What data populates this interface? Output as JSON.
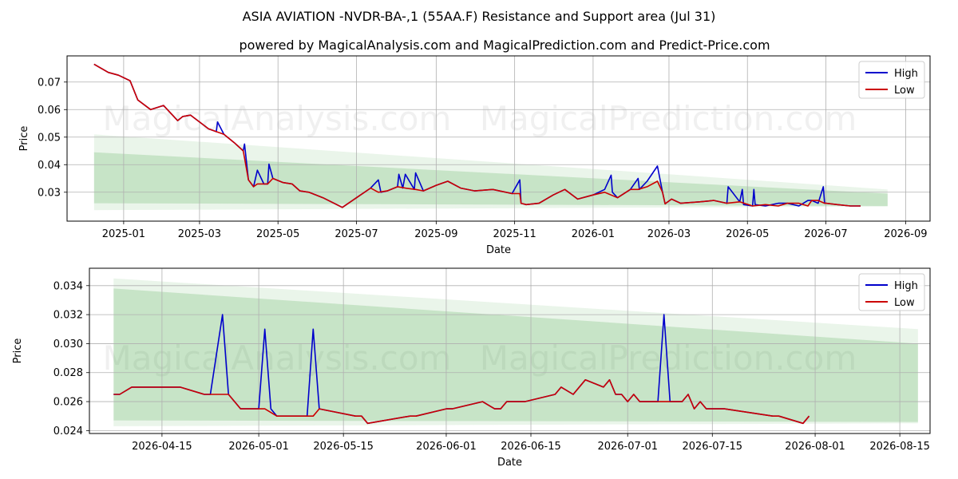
{
  "title": "ASIA AVIATION -NVDR-BA-,1 (55AA.F) Resistance and Support area (Jul 31)",
  "subtitle": "powered by MagicalAnalysis.com and MagicalPrediction.com and Predict-Price.com",
  "watermarks": [
    "MagicalAnalysis.com",
    "MagicalPrediction.com"
  ],
  "colors": {
    "high": "#0000cc",
    "low": "#cc0000",
    "band": "#2e9a2e"
  },
  "chart_data": [
    {
      "type": "line",
      "xlabel": "Date",
      "ylabel": "Price",
      "x_ticks": [
        "2025-01",
        "2025-03",
        "2025-05",
        "2025-07",
        "2025-09",
        "2025-11",
        "2026-01",
        "2026-03",
        "2026-05",
        "2026-07",
        "2026-09"
      ],
      "y_ticks": [
        "0.03",
        "0.04",
        "0.05",
        "0.06",
        "0.07"
      ],
      "xlim": [
        "2024-11-18",
        "2026-09-20"
      ],
      "ylim": [
        0.0195,
        0.0795
      ],
      "grid": true,
      "legend": "top-right",
      "bands": [
        {
          "x": [
            "2024-12-09",
            "2026-08-18"
          ],
          "upper": [
            0.051,
            0.031
          ],
          "lower": [
            0.0235,
            0.0248
          ]
        },
        {
          "x": [
            "2024-12-09",
            "2026-08-18"
          ],
          "upper": [
            0.0445,
            0.0295
          ],
          "lower": [
            0.026,
            0.025
          ]
        }
      ],
      "series": [
        {
          "name": "High",
          "x": [
            "2024-12-09",
            "2024-12-20",
            "2024-12-28",
            "2025-01-06",
            "2025-01-12",
            "2025-01-22",
            "2025-02-01",
            "2025-02-12",
            "2025-02-16",
            "2025-02-22",
            "2025-03-01",
            "2025-03-08",
            "2025-03-14",
            "2025-03-15",
            "2025-03-20",
            "2025-03-28",
            "2025-04-04",
            "2025-04-05",
            "2025-04-08",
            "2025-04-12",
            "2025-04-15",
            "2025-04-20",
            "2025-04-23",
            "2025-04-24",
            "2025-04-27",
            "2025-05-05",
            "2025-05-12",
            "2025-05-18",
            "2025-05-25",
            "2025-06-05",
            "2025-06-20",
            "2025-07-01",
            "2025-07-12",
            "2025-07-18",
            "2025-07-20",
            "2025-07-25",
            "2025-08-02",
            "2025-08-03",
            "2025-08-06",
            "2025-08-08",
            "2025-08-15",
            "2025-08-16",
            "2025-08-22",
            "2025-09-01",
            "2025-09-10",
            "2025-09-20",
            "2025-10-01",
            "2025-10-15",
            "2025-10-30",
            "2025-11-05",
            "2025-11-06",
            "2025-11-10",
            "2025-11-20",
            "2025-12-01",
            "2025-12-10",
            "2025-12-20",
            "2026-01-01",
            "2026-01-10",
            "2026-01-15",
            "2026-01-16",
            "2026-01-20",
            "2026-01-30",
            "2026-02-05",
            "2026-02-06",
            "2026-02-12",
            "2026-02-20",
            "2026-02-24",
            "2026-02-26",
            "2026-03-03",
            "2026-03-10",
            "2026-03-25",
            "2026-04-05",
            "2026-04-15",
            "2026-04-16",
            "2026-04-25",
            "2026-04-27",
            "2026-04-28",
            "2026-05-05",
            "2026-05-06",
            "2026-05-07",
            "2026-05-15",
            "2026-05-25",
            "2026-06-01",
            "2026-06-10",
            "2026-06-17",
            "2026-06-20",
            "2026-06-25",
            "2026-06-29",
            "2026-06-30",
            "2026-07-01",
            "2026-07-10",
            "2026-07-20",
            "2026-07-28"
          ],
          "values": [
            0.0765,
            0.0735,
            0.0725,
            0.0705,
            0.0635,
            0.06,
            0.0615,
            0.056,
            0.0575,
            0.058,
            0.0555,
            0.053,
            0.052,
            0.0555,
            0.051,
            0.048,
            0.045,
            0.0475,
            0.0345,
            0.032,
            0.038,
            0.033,
            0.033,
            0.0402,
            0.035,
            0.0335,
            0.033,
            0.0305,
            0.03,
            0.028,
            0.0245,
            0.028,
            0.0315,
            0.0345,
            0.03,
            0.0305,
            0.032,
            0.0365,
            0.0315,
            0.0365,
            0.031,
            0.037,
            0.0305,
            0.0325,
            0.034,
            0.0315,
            0.0305,
            0.031,
            0.0295,
            0.0345,
            0.026,
            0.0255,
            0.026,
            0.029,
            0.031,
            0.0275,
            0.029,
            0.031,
            0.0362,
            0.03,
            0.028,
            0.031,
            0.035,
            0.031,
            0.034,
            0.0395,
            0.03,
            0.0258,
            0.0275,
            0.026,
            0.0265,
            0.027,
            0.026,
            0.032,
            0.0265,
            0.031,
            0.0255,
            0.025,
            0.031,
            0.0255,
            0.025,
            0.026,
            0.026,
            0.025,
            0.027,
            0.027,
            0.026,
            0.032,
            0.026,
            0.026,
            0.0255,
            0.025,
            0.025
          ]
        },
        {
          "name": "Low",
          "x": [
            "2024-12-09",
            "2024-12-20",
            "2024-12-28",
            "2025-01-06",
            "2025-01-12",
            "2025-01-22",
            "2025-02-01",
            "2025-02-12",
            "2025-02-16",
            "2025-02-22",
            "2025-03-01",
            "2025-03-08",
            "2025-03-14",
            "2025-03-20",
            "2025-03-28",
            "2025-04-04",
            "2025-04-08",
            "2025-04-12",
            "2025-04-15",
            "2025-04-20",
            "2025-04-23",
            "2025-04-27",
            "2025-05-05",
            "2025-05-12",
            "2025-05-18",
            "2025-05-25",
            "2025-06-05",
            "2025-06-20",
            "2025-07-01",
            "2025-07-12",
            "2025-07-18",
            "2025-07-25",
            "2025-08-02",
            "2025-08-08",
            "2025-08-16",
            "2025-08-22",
            "2025-09-01",
            "2025-09-10",
            "2025-09-20",
            "2025-10-01",
            "2025-10-15",
            "2025-10-30",
            "2025-11-05",
            "2025-11-06",
            "2025-11-10",
            "2025-11-20",
            "2025-12-01",
            "2025-12-10",
            "2025-12-20",
            "2026-01-01",
            "2026-01-10",
            "2026-01-20",
            "2026-01-30",
            "2026-02-05",
            "2026-02-12",
            "2026-02-20",
            "2026-02-24",
            "2026-02-26",
            "2026-03-03",
            "2026-03-10",
            "2026-03-25",
            "2026-04-05",
            "2026-04-15",
            "2026-04-25",
            "2026-05-05",
            "2026-05-15",
            "2026-05-25",
            "2026-06-01",
            "2026-06-10",
            "2026-06-17",
            "2026-06-20",
            "2026-06-25",
            "2026-06-30",
            "2026-07-01",
            "2026-07-10",
            "2026-07-20",
            "2026-07-28"
          ],
          "values": [
            0.0765,
            0.0735,
            0.0725,
            0.0705,
            0.0635,
            0.06,
            0.0615,
            0.056,
            0.0575,
            0.058,
            0.0555,
            0.053,
            0.052,
            0.051,
            0.048,
            0.045,
            0.0345,
            0.032,
            0.033,
            0.033,
            0.033,
            0.035,
            0.0335,
            0.033,
            0.0305,
            0.03,
            0.028,
            0.0245,
            0.028,
            0.0315,
            0.03,
            0.0305,
            0.032,
            0.0315,
            0.031,
            0.0305,
            0.0325,
            0.034,
            0.0315,
            0.0305,
            0.031,
            0.0295,
            0.0295,
            0.026,
            0.0255,
            0.026,
            0.029,
            0.031,
            0.0275,
            0.029,
            0.03,
            0.028,
            0.031,
            0.031,
            0.032,
            0.034,
            0.03,
            0.0258,
            0.0275,
            0.026,
            0.0265,
            0.027,
            0.026,
            0.0265,
            0.025,
            0.0255,
            0.025,
            0.026,
            0.026,
            0.025,
            0.027,
            0.027,
            0.026,
            0.026,
            0.0255,
            0.025,
            0.025
          ]
        }
      ]
    },
    {
      "type": "line",
      "xlabel": "Date",
      "ylabel": "Price",
      "x_ticks": [
        "2026-04-15",
        "2026-05-01",
        "2026-05-15",
        "2026-06-01",
        "2026-06-15",
        "2026-07-01",
        "2026-07-15",
        "2026-08-01",
        "2026-08-15"
      ],
      "y_ticks": [
        "0.024",
        "0.026",
        "0.028",
        "0.030",
        "0.032",
        "0.034"
      ],
      "xlim": [
        "2026-04-03",
        "2026-08-20"
      ],
      "ylim": [
        0.0238,
        0.0352
      ],
      "grid": true,
      "legend": "top-right",
      "bands": [
        {
          "x": [
            "2026-04-07",
            "2026-08-18"
          ],
          "upper": [
            0.0345,
            0.031
          ],
          "lower": [
            0.0243,
            0.0245
          ]
        },
        {
          "x": [
            "2026-04-07",
            "2026-08-18"
          ],
          "upper": [
            0.0338,
            0.03
          ],
          "lower": [
            0.0247,
            0.0246
          ]
        }
      ],
      "series": [
        {
          "name": "High",
          "x": [
            "2026-04-07",
            "2026-04-08",
            "2026-04-10",
            "2026-04-17",
            "2026-04-18",
            "2026-04-22",
            "2026-04-23",
            "2026-04-25",
            "2026-04-26",
            "2026-04-28",
            "2026-05-01",
            "2026-05-02",
            "2026-05-03",
            "2026-05-04",
            "2026-05-08",
            "2026-05-09",
            "2026-05-10",
            "2026-05-11",
            "2026-05-17",
            "2026-05-18",
            "2026-05-19",
            "2026-05-26",
            "2026-05-27",
            "2026-06-01",
            "2026-06-02",
            "2026-06-07",
            "2026-06-09",
            "2026-06-10",
            "2026-06-11",
            "2026-06-14",
            "2026-06-19",
            "2026-06-20",
            "2026-06-22",
            "2026-06-24",
            "2026-06-27",
            "2026-06-28",
            "2026-06-29",
            "2026-06-30",
            "2026-07-01",
            "2026-07-02",
            "2026-07-03",
            "2026-07-04",
            "2026-07-05",
            "2026-07-06",
            "2026-07-07",
            "2026-07-08",
            "2026-07-09",
            "2026-07-10",
            "2026-07-11",
            "2026-07-12",
            "2026-07-13",
            "2026-07-14",
            "2026-07-16",
            "2026-07-17",
            "2026-07-25",
            "2026-07-26",
            "2026-07-30",
            "2026-07-31"
          ],
          "values": [
            0.0265,
            0.0265,
            0.027,
            0.027,
            0.027,
            0.0265,
            0.0265,
            0.032,
            0.0265,
            0.0255,
            0.0255,
            0.031,
            0.0255,
            0.025,
            0.025,
            0.025,
            0.031,
            0.0255,
            0.025,
            0.025,
            0.0245,
            0.025,
            0.025,
            0.0255,
            0.0255,
            0.026,
            0.0255,
            0.0255,
            0.026,
            0.026,
            0.0265,
            0.027,
            0.0265,
            0.0275,
            0.027,
            0.0275,
            0.0265,
            0.0265,
            0.026,
            0.0265,
            0.026,
            0.026,
            0.026,
            0.026,
            0.032,
            0.026,
            0.026,
            0.026,
            0.0265,
            0.0255,
            0.026,
            0.0255,
            0.0255,
            0.0255,
            0.025,
            0.025,
            0.0245,
            0.025
          ]
        },
        {
          "name": "Low",
          "x": [
            "2026-04-07",
            "2026-04-08",
            "2026-04-10",
            "2026-04-17",
            "2026-04-18",
            "2026-04-22",
            "2026-04-23",
            "2026-04-25",
            "2026-04-26",
            "2026-04-28",
            "2026-05-01",
            "2026-05-02",
            "2026-05-04",
            "2026-05-08",
            "2026-05-09",
            "2026-05-10",
            "2026-05-11",
            "2026-05-17",
            "2026-05-18",
            "2026-05-19",
            "2026-05-26",
            "2026-05-27",
            "2026-06-01",
            "2026-06-02",
            "2026-06-07",
            "2026-06-09",
            "2026-06-10",
            "2026-06-11",
            "2026-06-14",
            "2026-06-19",
            "2026-06-20",
            "2026-06-22",
            "2026-06-24",
            "2026-06-27",
            "2026-06-28",
            "2026-06-29",
            "2026-06-30",
            "2026-07-01",
            "2026-07-02",
            "2026-07-03",
            "2026-07-04",
            "2026-07-05",
            "2026-07-06",
            "2026-07-08",
            "2026-07-09",
            "2026-07-10",
            "2026-07-11",
            "2026-07-12",
            "2026-07-13",
            "2026-07-14",
            "2026-07-16",
            "2026-07-17",
            "2026-07-25",
            "2026-07-26",
            "2026-07-30",
            "2026-07-31"
          ],
          "values": [
            0.0265,
            0.0265,
            0.027,
            0.027,
            0.027,
            0.0265,
            0.0265,
            0.0265,
            0.0265,
            0.0255,
            0.0255,
            0.0255,
            0.025,
            0.025,
            0.025,
            0.025,
            0.0255,
            0.025,
            0.025,
            0.0245,
            0.025,
            0.025,
            0.0255,
            0.0255,
            0.026,
            0.0255,
            0.0255,
            0.026,
            0.026,
            0.0265,
            0.027,
            0.0265,
            0.0275,
            0.027,
            0.0275,
            0.0265,
            0.0265,
            0.026,
            0.0265,
            0.026,
            0.026,
            0.026,
            0.026,
            0.026,
            0.026,
            0.026,
            0.0265,
            0.0255,
            0.026,
            0.0255,
            0.0255,
            0.0255,
            0.025,
            0.025,
            0.0245,
            0.025
          ]
        }
      ]
    }
  ]
}
